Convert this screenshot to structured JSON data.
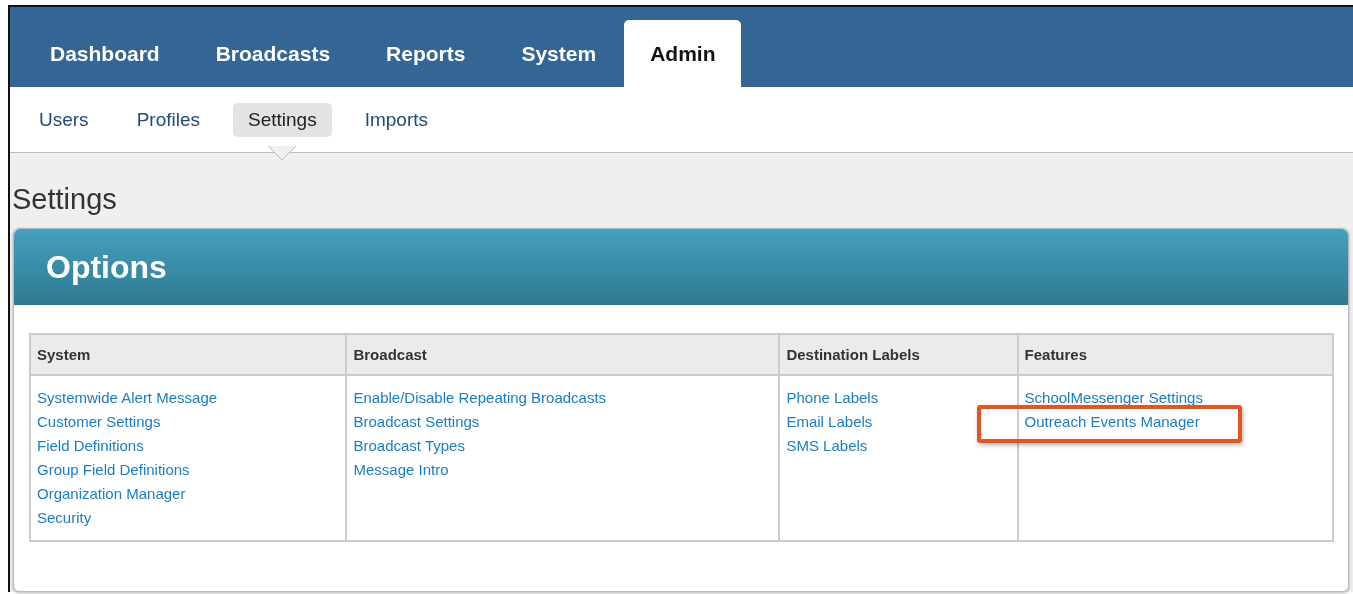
{
  "main_tabs": [
    {
      "label": "Dashboard",
      "selected": false
    },
    {
      "label": "Broadcasts",
      "selected": false
    },
    {
      "label": "Reports",
      "selected": false
    },
    {
      "label": "System",
      "selected": false
    },
    {
      "label": "Admin",
      "selected": true
    }
  ],
  "sub_tabs": [
    {
      "label": "Users",
      "selected": false
    },
    {
      "label": "Profiles",
      "selected": false
    },
    {
      "label": "Settings",
      "selected": true
    },
    {
      "label": "Imports",
      "selected": false
    }
  ],
  "page_title": "Settings",
  "panel": {
    "title": "Options",
    "columns": [
      {
        "heading": "System",
        "links": [
          {
            "label": "Systemwide Alert Message",
            "highlighted": false
          },
          {
            "label": "Customer Settings",
            "highlighted": false
          },
          {
            "label": "Field Definitions",
            "highlighted": false
          },
          {
            "label": "Group Field Definitions",
            "highlighted": false
          },
          {
            "label": "Organization Manager",
            "highlighted": false
          },
          {
            "label": "Security",
            "highlighted": false
          }
        ]
      },
      {
        "heading": "Broadcast",
        "links": [
          {
            "label": "Enable/Disable Repeating Broadcasts",
            "highlighted": false
          },
          {
            "label": "Broadcast Settings",
            "highlighted": false
          },
          {
            "label": "Broadcast Types",
            "highlighted": false
          },
          {
            "label": "Message Intro",
            "highlighted": false
          }
        ]
      },
      {
        "heading": "Destination Labels",
        "links": [
          {
            "label": "Phone Labels",
            "highlighted": false
          },
          {
            "label": "Email Labels",
            "highlighted": false
          },
          {
            "label": "SMS Labels",
            "highlighted": false
          }
        ]
      },
      {
        "heading": "Features",
        "links": [
          {
            "label": "SchoolMessenger Settings",
            "highlighted": false
          },
          {
            "label": "Outreach Events Manager",
            "highlighted": true
          }
        ]
      }
    ]
  }
}
